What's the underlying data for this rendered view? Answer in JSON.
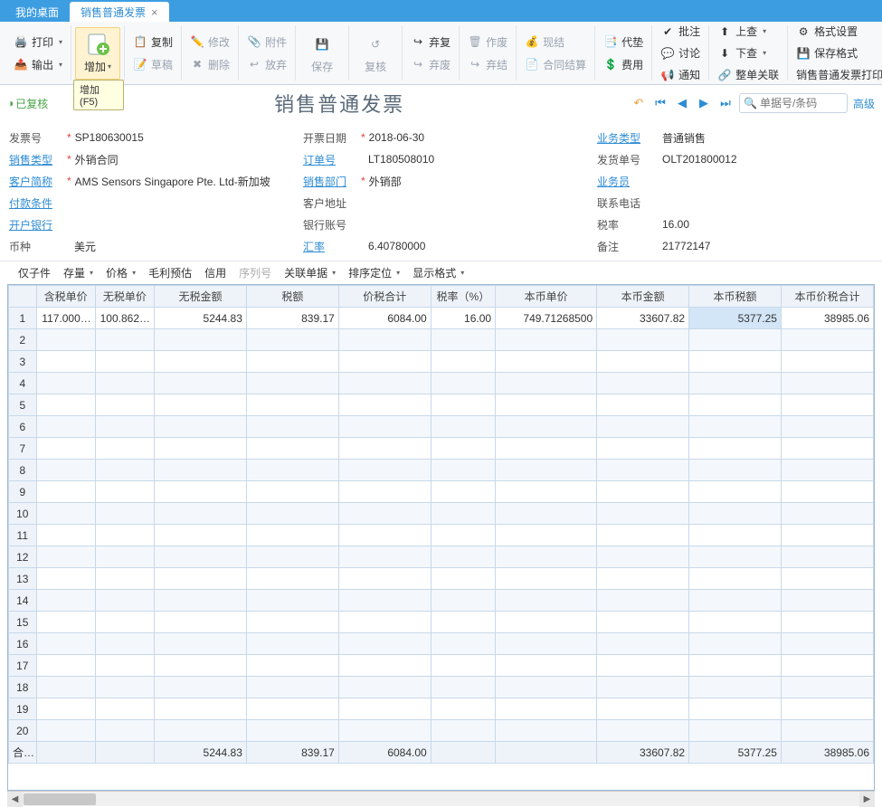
{
  "tabs": {
    "desktop": "我的桌面",
    "active": "销售普通发票"
  },
  "ribbon": {
    "print": "打印",
    "export": "输出",
    "add": "增加",
    "copy": "复制",
    "modify": "修改",
    "attach": "附件",
    "draft": "草稿",
    "delete": "删除",
    "release": "放弃",
    "save": "保存",
    "recheck": "复核",
    "discard": "弃复",
    "void": "作废",
    "discard2": "弃废",
    "current": "现结",
    "discard3": "弃结",
    "advance": "代垫",
    "fee": "费用",
    "contract": "合同结算",
    "approve": "批注",
    "discuss": "讨论",
    "notify": "通知",
    "up": "上查",
    "down": "下查",
    "zdgl": "整单关联",
    "format": "格式设置",
    "saveformat": "保存格式",
    "printmenu": "销售普通发票打印",
    "add_tip": "增加(F5)"
  },
  "status": "已复核",
  "title": "销售普通发票",
  "search_placeholder": "单据号/条码",
  "adv_label": "高级",
  "form": {
    "col1": {
      "invoice_no_l": "发票号",
      "invoice_no_v": "SP180630015",
      "sale_type_l": "销售类型",
      "sale_type_v": "外销合同",
      "cust_l": "客户简称",
      "cust_v": "AMS Sensors Singapore Pte. Ltd-新加坡",
      "pay_l": "付款条件",
      "bank_l": "开户银行",
      "curr_l": "币种",
      "curr_v": "美元"
    },
    "col2": {
      "date_l": "开票日期",
      "date_v": "2018-06-30",
      "order_l": "订单号",
      "order_v": "LT180508010",
      "dept_l": "销售部门",
      "dept_v": "外销部",
      "addr_l": "客户地址",
      "acct_l": "银行账号",
      "rate_l": "汇率",
      "rate_v": "6.40780000"
    },
    "col3": {
      "biz_l": "业务类型",
      "biz_v": "普通销售",
      "ship_l": "发货单号",
      "ship_v": "OLT201800012",
      "sales_l": "业务员",
      "tel_l": "联系电话",
      "tax_l": "税率",
      "tax_v": "16.00",
      "memo_l": "备注",
      "memo_v": "21772147"
    }
  },
  "gridbar": {
    "child": "仅子件",
    "stock": "存量",
    "price": "价格",
    "profit": "毛利预估",
    "credit": "信用",
    "serial": "序列号",
    "related": "关联单据",
    "sort": "排序定位",
    "display": "显示格式"
  },
  "columns": [
    "含税单价",
    "无税单价",
    "无税金额",
    "税额",
    "价税合计",
    "税率（%）",
    "本币单价",
    "本币金额",
    "本币税额",
    "本币价税合计"
  ],
  "row1": [
    "117.000…",
    "100.862…",
    "5244.83",
    "839.17",
    "6084.00",
    "16.00",
    "749.71268500",
    "33607.82",
    "5377.25",
    "38985.06"
  ],
  "totals_label": "合计",
  "totals": [
    "",
    "",
    "5244.83",
    "839.17",
    "6084.00",
    "",
    "",
    "33607.82",
    "5377.25",
    "38985.06"
  ]
}
